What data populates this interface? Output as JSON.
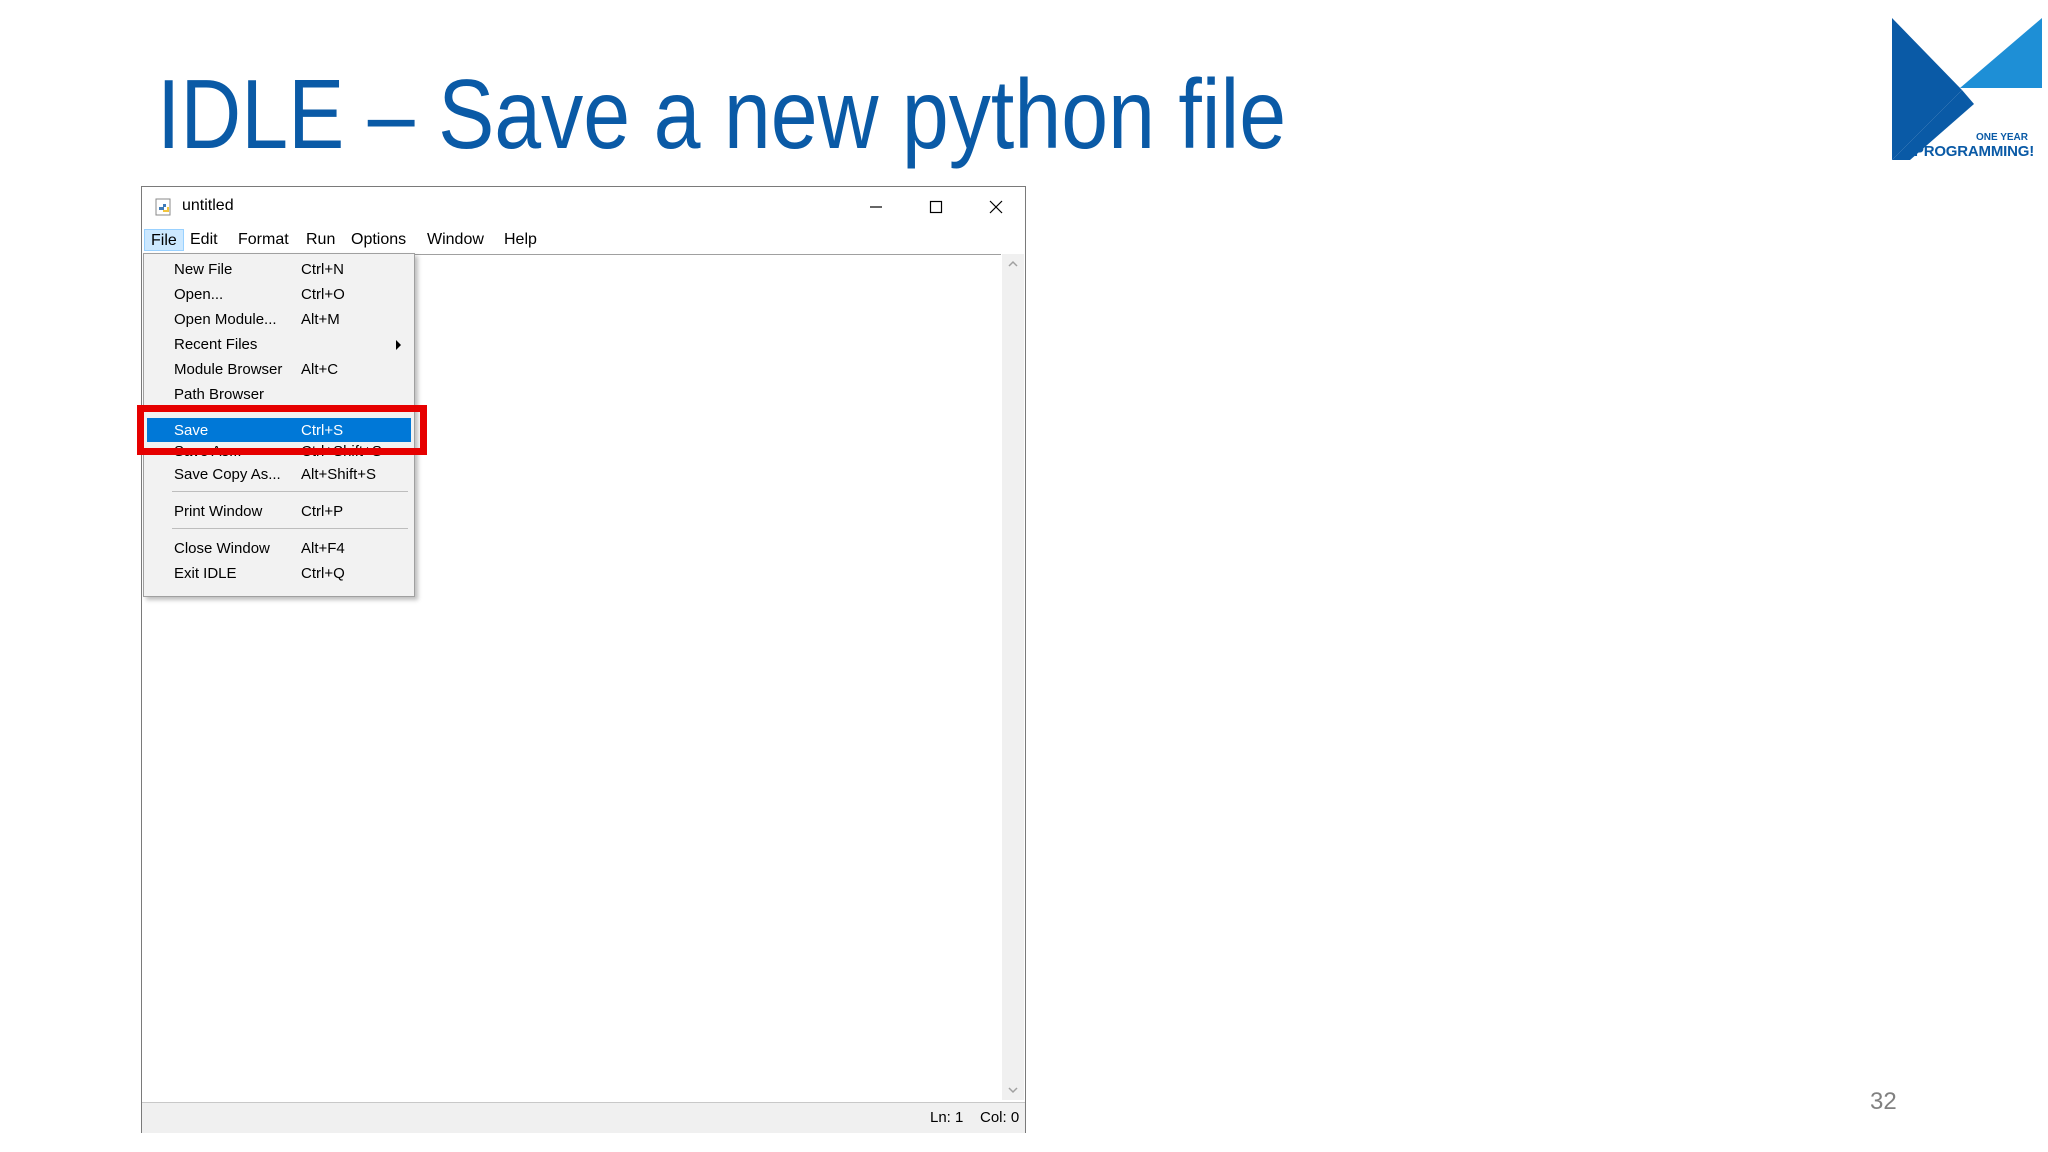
{
  "slide": {
    "title": "IDLE – Save a new python file",
    "page_number": "32",
    "logo": {
      "tagline": "ONE YEAR",
      "brand": "PROGRAMMING!"
    }
  },
  "window": {
    "title": "untitled",
    "icons": {
      "app": "python-idle-icon",
      "minimize": "minimize-icon",
      "maximize": "maximize-icon",
      "close": "close-icon"
    }
  },
  "menubar": {
    "items": [
      {
        "label": "File",
        "active": true
      },
      {
        "label": "Edit"
      },
      {
        "label": "Format"
      },
      {
        "label": "Run"
      },
      {
        "label": "Options"
      },
      {
        "label": "Window"
      },
      {
        "label": "Help"
      }
    ]
  },
  "file_menu": {
    "items": [
      {
        "label": "New File",
        "shortcut": "Ctrl+N"
      },
      {
        "label": "Open...",
        "shortcut": "Ctrl+O"
      },
      {
        "label": "Open Module...",
        "shortcut": "Alt+M"
      },
      {
        "label": "Recent Files",
        "shortcut": "",
        "submenu": true
      },
      {
        "label": "Module Browser",
        "shortcut": "Alt+C"
      },
      {
        "label": "Path Browser",
        "shortcut": ""
      },
      {
        "label": "Save",
        "shortcut": "Ctrl+S",
        "highlighted": true
      },
      {
        "label": "Save As...",
        "shortcut": "Ctrl+Shift+S"
      },
      {
        "label": "Save Copy As...",
        "shortcut": "Alt+Shift+S"
      },
      {
        "label": "Print Window",
        "shortcut": "Ctrl+P"
      },
      {
        "label": "Close Window",
        "shortcut": "Alt+F4"
      },
      {
        "label": "Exit IDLE",
        "shortcut": "Ctrl+Q"
      }
    ]
  },
  "statusbar": {
    "line": "Ln: 1",
    "column": "Col: 0"
  },
  "colors": {
    "title_blue": "#0a5aa6",
    "logo_light_blue": "#1e8fd6",
    "highlight_blue": "#0078d7",
    "callout_red": "#e60000"
  }
}
